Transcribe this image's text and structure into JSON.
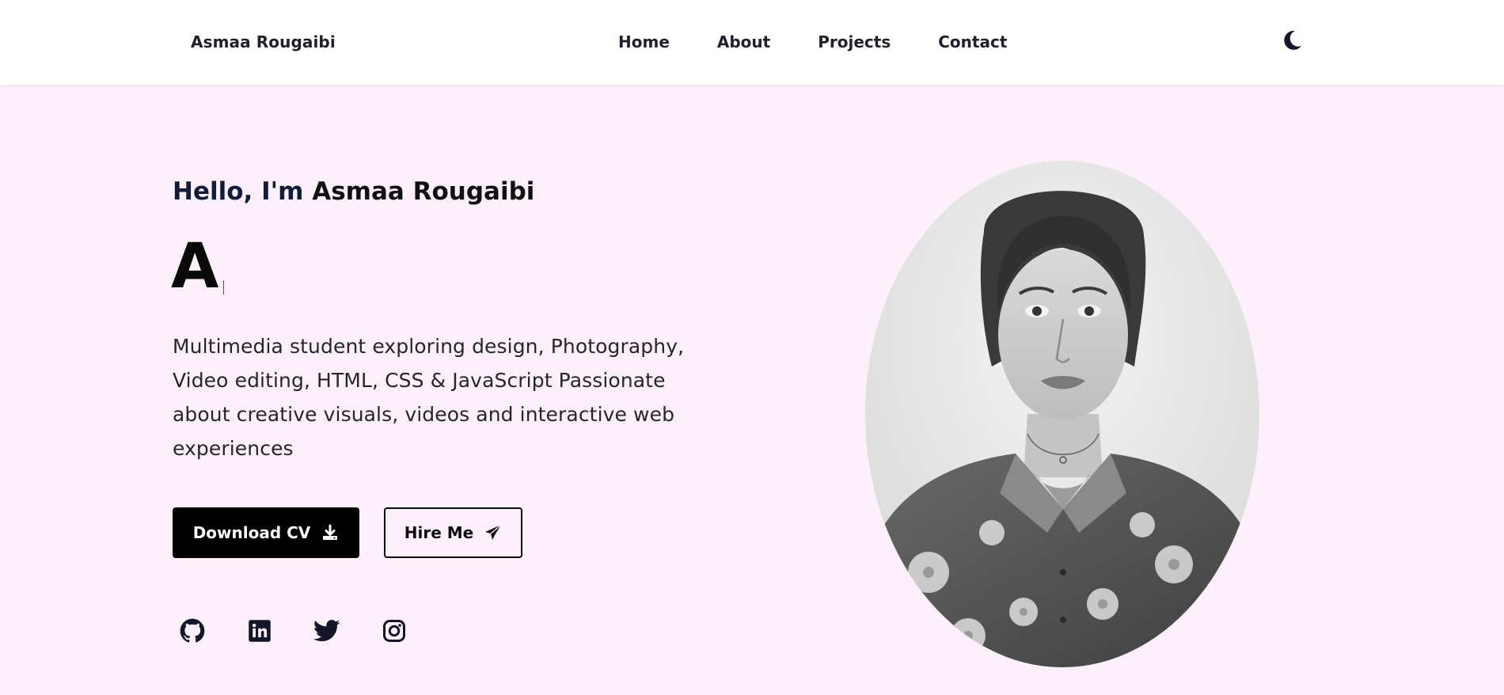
{
  "header": {
    "logo": "Asmaa Rougaibi",
    "nav": [
      "Home",
      "About",
      "Projects",
      "Contact"
    ],
    "theme_icon": "moon-icon"
  },
  "hero": {
    "greeting_prefix": "Hello, I'm",
    "greeting_name": "Asmaa Rougaibi",
    "typed_text": "A",
    "intro": "Multimedia student exploring design, Photography, Video editing, HTML, CSS & JavaScript Passionate about creative visuals, videos and interactive web experiences",
    "buttons": {
      "download_cv": "Download CV",
      "download_icon": "download-icon",
      "hire_me": "Hire Me",
      "hire_icon": "paper-plane-icon"
    },
    "socials": [
      "github-icon",
      "linkedin-icon",
      "twitter-icon",
      "instagram-icon"
    ]
  },
  "colors": {
    "background": "#fdf0fb",
    "header_bg": "#ffffff",
    "primary_button": "#000000",
    "navy_text": "#0f1d3a"
  }
}
